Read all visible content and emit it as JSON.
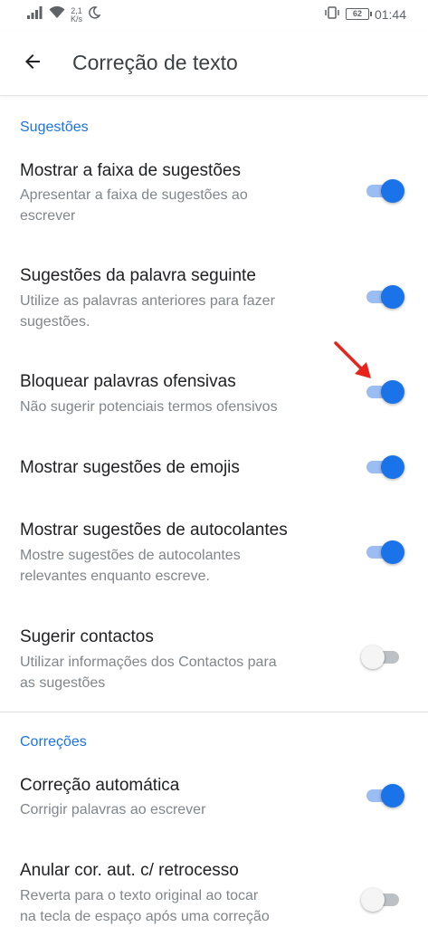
{
  "status_bar": {
    "network_speed_value": "2,1",
    "network_speed_unit": "K/s",
    "battery_level": "62",
    "time": "01:44",
    "icons": [
      "signal-icon",
      "wifi-icon",
      "moon-icon",
      "vibrate-icon",
      "battery-icon"
    ]
  },
  "app_bar": {
    "back_icon": "arrow-back-icon",
    "title": "Correção de texto"
  },
  "sections": {
    "suggestions": "Sugestões",
    "corrections": "Correções"
  },
  "settings": [
    {
      "title": "Mostrar a faixa de sugestões",
      "summary_lines": [
        "Apresentar a faixa de sugestões ao",
        "escrever"
      ],
      "enabled": true
    },
    {
      "title": "Sugestões da palavra seguinte",
      "summary_lines": [
        "Utilize as palavras anteriores para fazer",
        "sugestões."
      ],
      "enabled": true
    },
    {
      "title": "Bloquear palavras ofensivas",
      "summary_lines": [
        "Não sugerir potenciais termos ofensivos"
      ],
      "enabled": true
    },
    {
      "title": "Mostrar sugestões de emojis",
      "summary_lines": [],
      "enabled": true
    },
    {
      "title": "Mostrar sugestões de autocolantes",
      "summary_lines": [
        "Mostre sugestões de autocolantes",
        "relevantes enquanto escreve."
      ],
      "enabled": true
    },
    {
      "title": "Sugerir contactos",
      "summary_lines": [
        "Utilizar informações dos Contactos para",
        "as sugestões"
      ],
      "enabled": false
    },
    {
      "title": "Correção automática",
      "summary_lines": [
        "Corrigir palavras ao escrever"
      ],
      "enabled": true
    },
    {
      "title": "Anular cor. aut. c/ retrocesso",
      "summary_lines": [
        "Reverta para o texto original ao tocar",
        "na tecla de espaço após uma correção"
      ],
      "enabled": false
    }
  ],
  "colors": {
    "accent": "#1a73e8",
    "switch_on_track": "#9bbdf3",
    "switch_off_track": "#bdc1c6",
    "annotation_arrow": "#e8231b"
  }
}
